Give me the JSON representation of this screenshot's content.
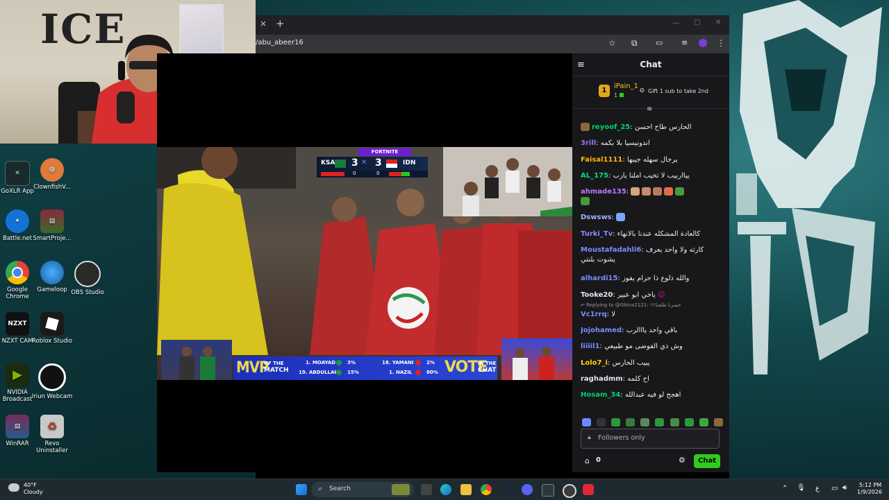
{
  "browser": {
    "url": "/abu_abeer16",
    "tab_close": "×",
    "new_tab": "+",
    "window_controls": [
      "—",
      "▢",
      "✕"
    ]
  },
  "webcam": {
    "wall_text": "ICE"
  },
  "desktop_icons": [
    {
      "label": "GoXLR App",
      "color": "#1a2a2a"
    },
    {
      "label": "ClownfishV...",
      "color": "#d86a2a"
    },
    {
      "label": "Battle.net",
      "color": "#1472d6"
    },
    {
      "label": "SmartProje...",
      "color": "#8a2a3a"
    },
    {
      "label": "Google Chrome",
      "color": "#ffffff"
    },
    {
      "label": "Gameloop",
      "color": "#2a8ad6"
    },
    {
      "label": "OBS Studio",
      "color": "#2a2a2a"
    },
    {
      "label": "NZXT CAM",
      "color": "#111111"
    },
    {
      "label": "Roblox Studio",
      "color": "#1a1a1a"
    },
    {
      "label": "NVIDIA Broadcast",
      "color": "#1c2a10"
    },
    {
      "label": "Iriun Webcam",
      "color": "#111111"
    },
    {
      "label": "WinRAR",
      "color": "#7a2a5a"
    },
    {
      "label": "Revo Uninstaller",
      "color": "#c0402a"
    }
  ],
  "video": {
    "banner": "FORTNITE",
    "team_left": "KSA",
    "team_right": "IDN",
    "score_left": "3",
    "score_right": "3",
    "sub_left": "0",
    "sub_right": "0",
    "mvp": "MVP",
    "of_the_match": [
      "OF THE",
      "MATCH"
    ],
    "players": [
      {
        "name": "1. MOAYAD",
        "pct": "3%"
      },
      {
        "name": "19. ABDULLAH",
        "pct": "15%"
      },
      {
        "name": "18. YAMANI",
        "pct": "2%"
      },
      {
        "name": "1. NAZIL",
        "pct": "80%"
      }
    ],
    "vote": "VOTE",
    "in_the_chat": [
      "IN THE",
      "CHAT"
    ]
  },
  "chat": {
    "title": "Chat",
    "leader_rank": "1",
    "leader_name": "iPain_1",
    "leader_count": "1",
    "gift_text": "Gift 1 sub to take 2nd",
    "messages": [
      {
        "user": "reyoof_25",
        "color": "#00d26a",
        "text": "الحارس طاح احسن"
      },
      {
        "user": "3rill",
        "color": "#9b73ff",
        "text": "اندونيسيا بلا بكمه"
      },
      {
        "user": "Faisal1111",
        "color": "#ffb400",
        "text": "يرجال سهله جيبها"
      },
      {
        "user": "AL_175",
        "color": "#00e07a",
        "text": "ييااربيب لا تخيب املنا يارب"
      },
      {
        "user": "ahmade135",
        "color": "#b87cff",
        "text": ""
      },
      {
        "user": "Dswsws",
        "color": "#9bb6ff",
        "text": ""
      },
      {
        "user": "Turki_Tv",
        "color": "#8a8aff",
        "text": "كالعادة المشكله عندنا بالانهاء"
      },
      {
        "user": "Moustafadahli6",
        "color": "#7a8fff",
        "text": "كارثه ولا واحد يعرف يشوت بلنتي"
      },
      {
        "user": "alhardi15",
        "color": "#7a8fff",
        "text": "والله ذلوع ذا حرام يفوز"
      },
      {
        "user": "Tooke20",
        "color": "#e6e6ea",
        "text": "ياخي ابو عبير"
      },
      {
        "reply": "Replying to @Ghina2121: !!!خسرنا طلعنا"
      },
      {
        "user": "Vc1rrq",
        "color": "#7a8fff",
        "text": "لا"
      },
      {
        "user": "Jojohamed",
        "color": "#7a8fff",
        "text": "باقي واحد يااالرب"
      },
      {
        "user": "liiiil1",
        "color": "#7a8fff",
        "text": "وش ذي الفوضى مو طبيعي"
      },
      {
        "user": "Lolo7_i",
        "color": "#ffd400",
        "text": "يبيب الحارس"
      },
      {
        "user": "raghadmm",
        "color": "#e6e6ea",
        "text": "اح كلمه"
      },
      {
        "user": "Hosam_34",
        "color": "#00d26a",
        "text": "اهجح لو فيه عبدالله"
      }
    ],
    "input_placeholder": "Followers only",
    "points": "0",
    "send_label": "Chat"
  },
  "taskbar": {
    "weather_temp": "40°F",
    "weather_desc": "Cloudy",
    "search_label": "Search",
    "lang": "ع",
    "time": "5:12 PM",
    "date": "1/9/2026"
  }
}
